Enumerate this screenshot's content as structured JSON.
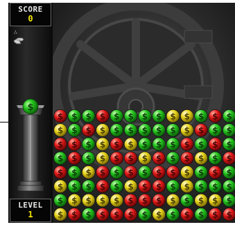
{
  "hud": {
    "score_label": "SCORE",
    "score_value": "0",
    "level_label": "LEVEL",
    "level_value": "1"
  },
  "next_piece": {
    "symbol": "$",
    "color": "green"
  },
  "colors": {
    "red": "#e01818",
    "green": "#22c21c",
    "yellow": "#e6d21a",
    "hud_value": "#f2e300"
  },
  "board": {
    "columns": 13,
    "rows": [
      [
        "red",
        "green",
        "green",
        "red",
        "green",
        "green",
        "green",
        "green",
        "yellow",
        "yellow",
        "green",
        "red",
        "green"
      ],
      [
        "yellow",
        "green",
        "red",
        "yellow",
        "green",
        "green",
        "green",
        "green",
        "green",
        "yellow",
        "red",
        "green",
        "green"
      ],
      [
        "red",
        "red",
        "green",
        "yellow",
        "red",
        "yellow",
        "green",
        "green",
        "green",
        "red",
        "green",
        "red",
        "green"
      ],
      [
        "green",
        "red",
        "green",
        "yellow",
        "red",
        "red",
        "yellow",
        "red",
        "green",
        "red",
        "yellow",
        "green",
        "red"
      ],
      [
        "red",
        "green",
        "yellow",
        "red",
        "green",
        "red",
        "green",
        "red",
        "red",
        "yellow",
        "green",
        "red",
        "green"
      ],
      [
        "yellow",
        "green",
        "green",
        "red",
        "green",
        "yellow",
        "red",
        "red",
        "green",
        "yellow",
        "green",
        "green",
        "green"
      ],
      [
        "green",
        "yellow",
        "yellow",
        "yellow",
        "yellow",
        "red",
        "red",
        "red",
        "yellow",
        "green",
        "yellow",
        "yellow",
        "green"
      ],
      [
        "yellow",
        "red",
        "green",
        "red",
        "red",
        "red",
        "green",
        "yellow",
        "green",
        "red",
        "green",
        "red",
        "red"
      ]
    ]
  }
}
